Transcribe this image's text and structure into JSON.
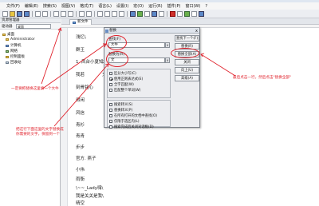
{
  "menubar": [
    "文件(F)",
    "编辑(E)",
    "搜索(S)",
    "视图(V)",
    "格式(T)",
    "语言(L)",
    "设置(I)",
    "宏(O)",
    "运行(R)",
    "插件(P)",
    "窗口(W)",
    "?"
  ],
  "sidebar": {
    "header": "资源管理器",
    "row_label": "驱动器",
    "row_value": "桌面",
    "tree": [
      "桌面",
      "Administrator",
      "计算机",
      "网络",
      "控制面板",
      "回收站"
    ]
  },
  "editor": {
    "tab_label": "新文件",
    "lines": [
      "浅忆\\",
      "群王",
      "1. 凤台小夏知",
      "我若",
      "刻骨铭心",
      "得闲",
      "风信",
      "青衫",
      "青青",
      "步步",
      "官方. 燕子",
      "小伟",
      "雨衡",
      "\\~~_Lady嗨\\",
      "我是关关是我\\",
      "晴空"
    ],
    "marker_1": "大牛",
    "marker_2": "文"
  },
  "dialog": {
    "title": "替换",
    "close_glyph": "x",
    "find_label": "查找(F)",
    "find_value": "大牛",
    "replace_label": "替换为(R)",
    "replace_value": "文",
    "dropdown_glyph": "v",
    "buttons": [
      "查找下一个(F)",
      "替换(R)",
      "替换全部(A)",
      "关闭",
      "向上(U)",
      "高级(A)"
    ],
    "options": [
      {
        "label": "区分大小写(C)",
        "checked": false
      },
      {
        "label": "使用正则表达式(E)",
        "checked": true
      },
      {
        "label": "全字匹配(W)",
        "checked": false
      },
      {
        "label": "匹配整个单词(W)",
        "checked": false
      },
      {
        "label": "搜索转义(S)",
        "checked": false
      },
      {
        "label": "替换转义(P)",
        "checked": false
      },
      {
        "label": "在所有打开的文档中查找(O)",
        "checked": false
      },
      {
        "label": "仅限于选区内(L)",
        "checked": false
      },
      {
        "label": "搜索完成后关闭对话框(D)",
        "checked": false
      }
    ]
  },
  "annotations": {
    "left": "一定要把替换这里填一个大牛",
    "middle": [
      "把这行下面这里的文字替换成",
      "你需要的文字，保留到一个"
    ],
    "right": "最后点击一行，然后点击\"替换全部\""
  },
  "colors": {
    "annotation": "#e0202a",
    "accent": "#5c88c8"
  }
}
